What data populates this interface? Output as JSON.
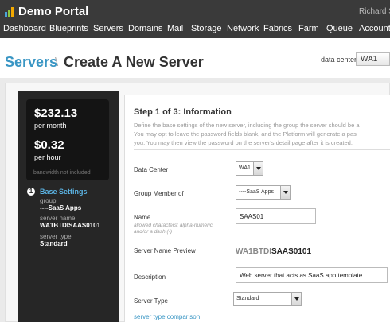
{
  "header": {
    "app_title": "Demo Portal",
    "user_name": "Richard Se",
    "nav": [
      "Dashboard",
      "Blueprints",
      "Servers",
      "Domains",
      "Mail",
      "Storage",
      "Network",
      "Fabrics",
      "Farm",
      "Queue",
      "Account"
    ]
  },
  "breadcrumb": {
    "section": "Servers",
    "separator": "\\",
    "page": "Create A New Server"
  },
  "data_center_selector": {
    "label": "data center:",
    "value": "WA1"
  },
  "pricing": {
    "monthly_price": "$232.13",
    "monthly_unit": "per month",
    "hourly_price": "$0.32",
    "hourly_unit": "per hour",
    "bandwidth_note": "bandwidth not included"
  },
  "wizard_sidebar": {
    "step_number": "1",
    "step_title": "Base Settings",
    "group_label": "group",
    "group_value": "----SaaS Apps",
    "server_name_label": "server name",
    "server_name_value": "WA1BTDISAAS0101",
    "server_type_label": "server type",
    "server_type_value": "Standard"
  },
  "form": {
    "step_header": "Step 1 of 3: Information",
    "description_lines": [
      "Define the base settings of the new server, including the group the server should be a",
      "You may opt to leave the password fields blank, and the Platform will generate a pas",
      "you. You may then view the password on the server's detail page after it is created."
    ],
    "data_center": {
      "label": "Data Center",
      "value": "WA1"
    },
    "group_member": {
      "label": "Group Member of",
      "value": "----SaaS Apps"
    },
    "name": {
      "label": "Name",
      "hint_line1": "allowed characters: alpha-numeric",
      "hint_line2": "and/or a dash (-)",
      "value": "SAAS01"
    },
    "preview": {
      "label": "Server Name Preview",
      "prefix": "WA1BTDI",
      "suffix": "SAAS0101"
    },
    "description": {
      "label": "Description",
      "value": "Web server that acts as SaaS app template"
    },
    "server_type": {
      "label": "Server Type",
      "value": "Standard"
    },
    "comparison_link": "server type comparison"
  },
  "colors": {
    "header_bg": "#3a3a3a",
    "accent_blue": "#3a96c4",
    "sidebar_bg": "#262626"
  }
}
